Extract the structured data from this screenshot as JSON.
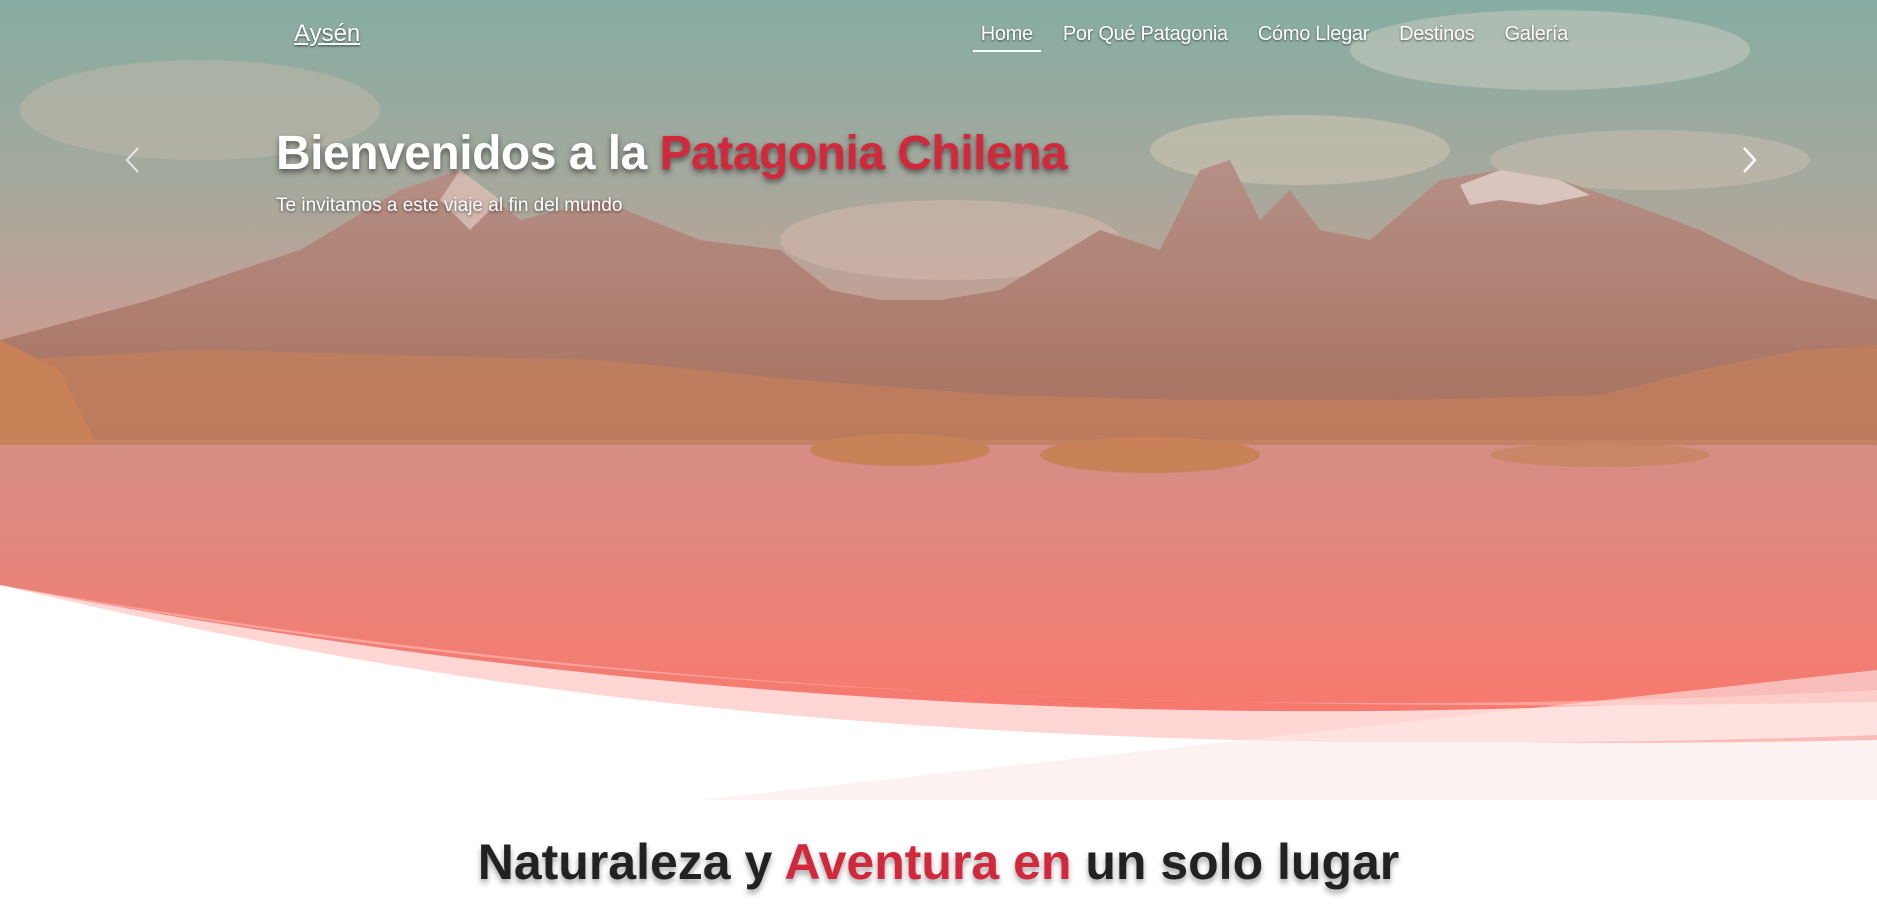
{
  "nav": {
    "brand": "Aysén",
    "items": [
      {
        "label": "Home",
        "active": true
      },
      {
        "label": "Por Qué Patagonia",
        "active": false
      },
      {
        "label": "Cómo Llegar",
        "active": false
      },
      {
        "label": "Destinos",
        "active": false
      },
      {
        "label": "Galería",
        "active": false
      }
    ]
  },
  "hero": {
    "title_prefix": "Bienvenidos a la ",
    "title_accent": "Patagonia Chilena",
    "subtitle": "Te invitamos a este viaje al fin del mundo",
    "prev_icon": "chevron-left-icon",
    "next_icon": "chevron-right-icon",
    "image": "patagonia-mountains-lake-photo"
  },
  "section": {
    "title_part1": "Naturaleza y ",
    "title_accent": "Aventura en",
    "title_part2": " un solo lugar"
  },
  "colors": {
    "accent": "#d2283b",
    "wave": "#ff7468",
    "wave_light": "#ffa39b",
    "wave_lighter": "#ffd6d3"
  }
}
